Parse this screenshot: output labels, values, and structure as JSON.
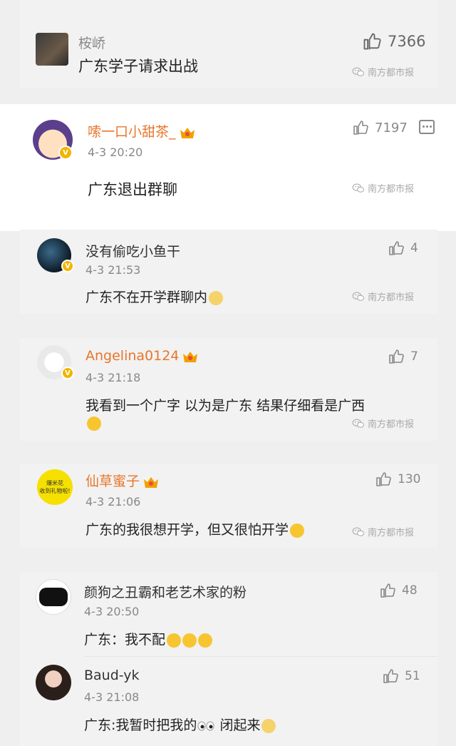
{
  "comments": [
    {
      "name": "桉峤",
      "text": "广东学子请求出战",
      "likes": "7366"
    },
    {
      "name": "嗦一口小甜茶_",
      "time": "4-3 20:20",
      "text": "广东退出群聊",
      "likes": "7197"
    },
    {
      "name": "没有偷吃小鱼干",
      "time": "4-3 21:53",
      "text": "广东不在开学群聊内",
      "likes": "4"
    },
    {
      "name": "Angelina0124",
      "time": "4-3 21:18",
      "text": "我看到一个广字 以为是广东 结果仔细看是广西",
      "likes": "7"
    },
    {
      "name": "仙草蜜子",
      "time": "4-3 21:06",
      "text": "广东的我很想开学，但又很怕开学",
      "likes": "130",
      "avatar_text": [
        "爆米花",
        "收到礼物啦!"
      ]
    },
    {
      "name": "颜狗之丑霸和老艺术家的粉",
      "time": "4-3 20:50",
      "text": "广东：我不配",
      "likes": "48"
    },
    {
      "name": "Baud-yk",
      "time": "4-3 21:08",
      "text_before": "广东:我暂时把我的",
      "text_after": " 闭起来",
      "likes": "51"
    }
  ],
  "watermark": "南方都市报",
  "colors": {
    "accent_name": "#e8762b",
    "vip": "#f2b500"
  },
  "icons": {
    "like": "thumbs-up-icon",
    "reply": "comment-icon",
    "badge": "vip-badge-icon"
  }
}
